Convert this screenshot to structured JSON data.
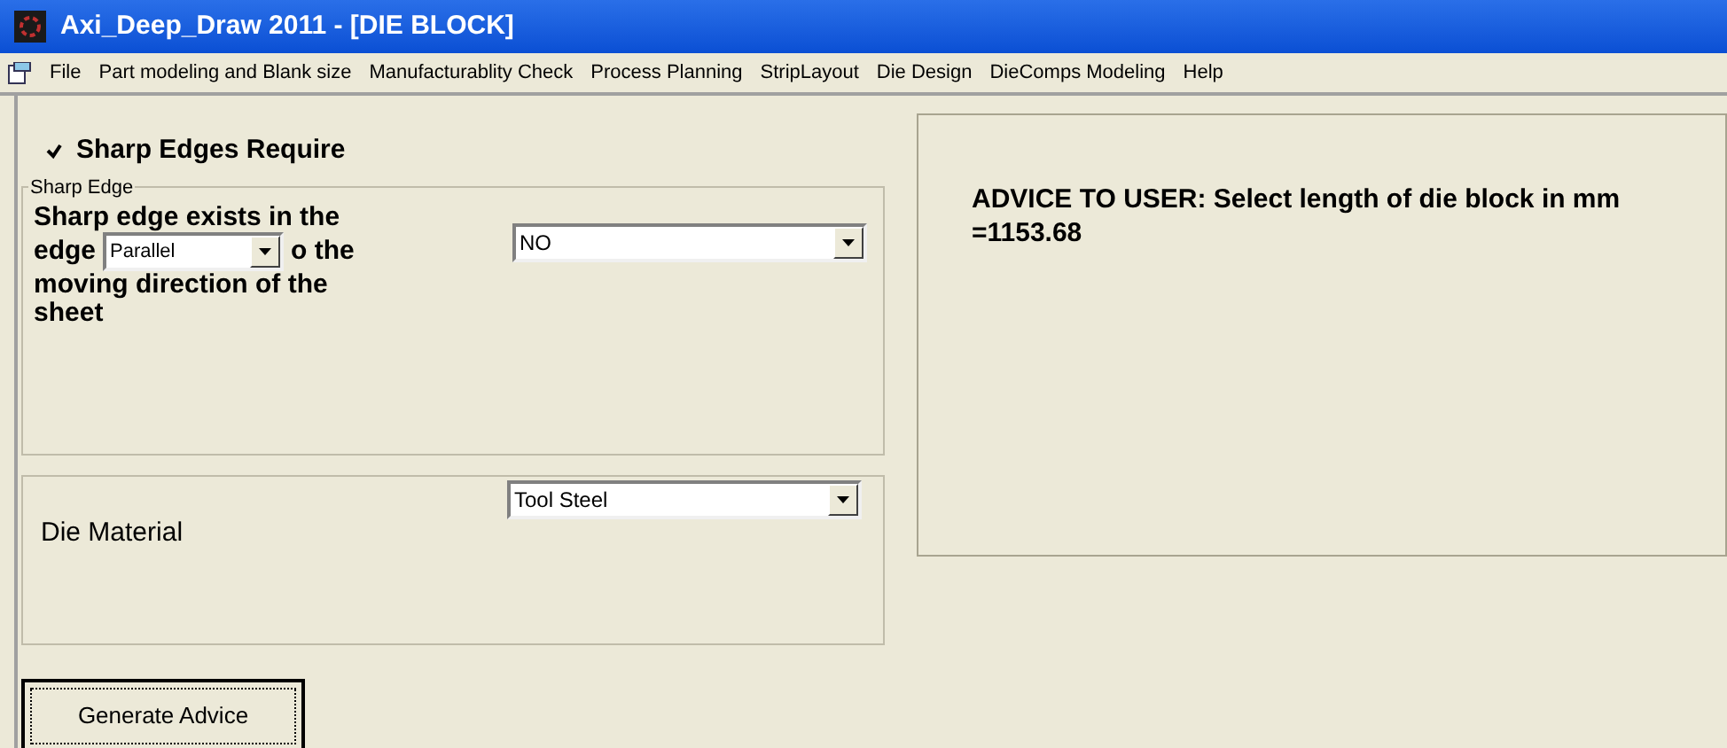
{
  "window": {
    "title": "Axi_Deep_Draw 2011 - [DIE BLOCK]"
  },
  "menu": [
    "File",
    "Part modeling and Blank size",
    "Manufacturablity Check",
    "Process Planning",
    "StripLayout",
    "Die Design",
    "DieComps Modeling",
    "Help"
  ],
  "sharp_edges_checkbox": {
    "label": "Sharp Edges Require",
    "checked": true
  },
  "sharp_edge_group": {
    "title": "Sharp Edge",
    "text_before": [
      "Sharp edge exists in the",
      "edge"
    ],
    "direction_dropdown": {
      "value": "Parallel"
    },
    "text_after": [
      "o the",
      "moving direction of the",
      "sheet"
    ],
    "answer_dropdown": {
      "value": "NO"
    }
  },
  "die_material_group": {
    "label": "Die Material",
    "dropdown": {
      "value": "Tool Steel"
    }
  },
  "generate_button": "Generate Advice",
  "advice": "ADVICE TO USER: Select length of die block in mm =1153.68"
}
